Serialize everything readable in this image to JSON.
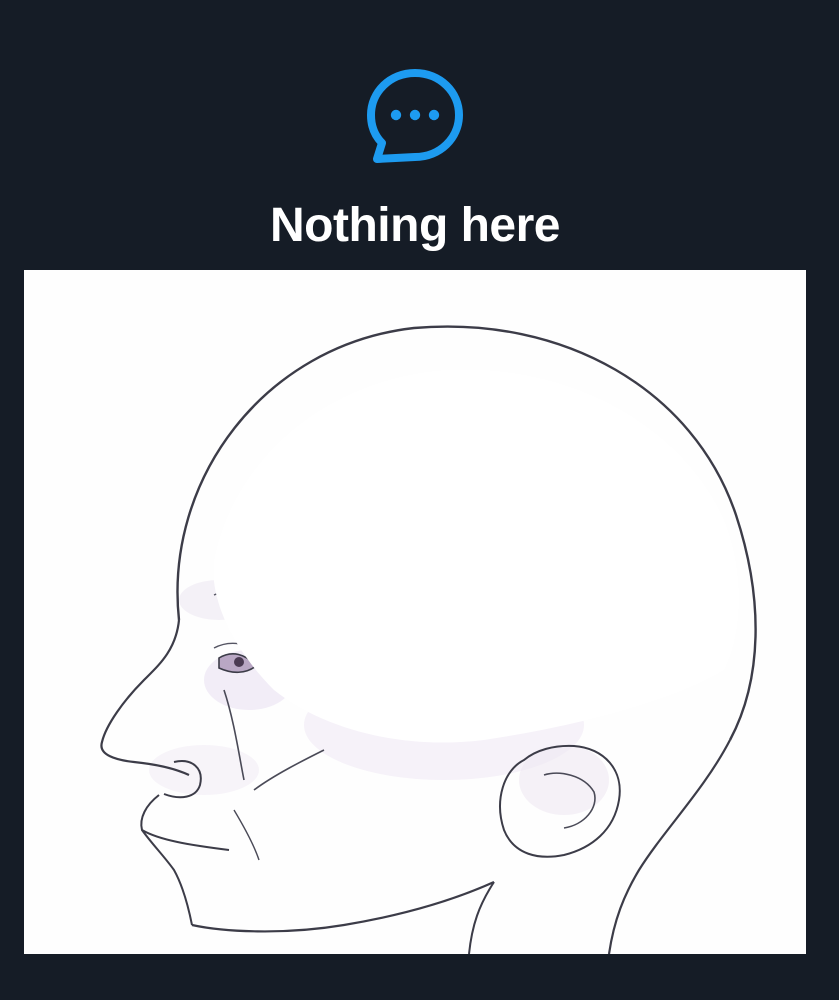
{
  "empty_state": {
    "icon": "chat-bubble-ellipsis-icon",
    "title": "Nothing here"
  },
  "colors": {
    "background": "#151c26",
    "accent": "#1d9bf0",
    "title_text": "#ffffff"
  },
  "attachment": {
    "kind": "image",
    "subject": "head-profile-sketch"
  }
}
